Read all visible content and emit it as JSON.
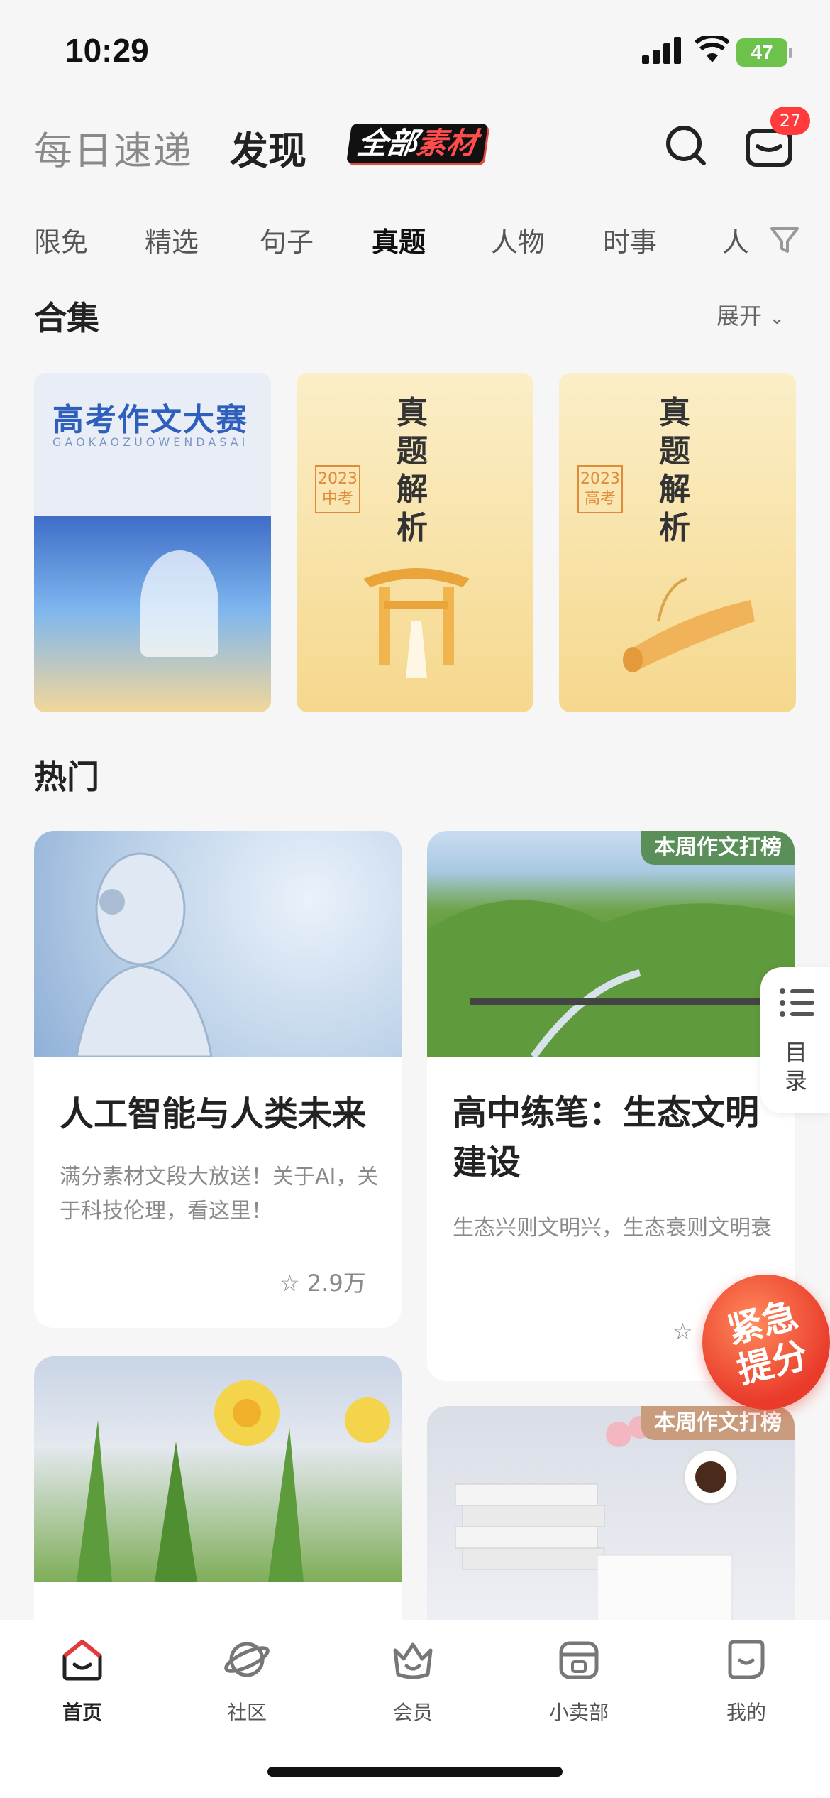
{
  "status_bar": {
    "time": "10:29",
    "battery": "47"
  },
  "header": {
    "tabs": [
      {
        "label": "每日速递"
      },
      {
        "label": "发现"
      }
    ],
    "all_materials": {
      "part1": "全部",
      "part2": "素材"
    },
    "mail_badge": "27"
  },
  "categories": [
    "限免",
    "精选",
    "句子",
    "真题",
    "人物",
    "时事",
    "人"
  ],
  "collections": {
    "title": "合集",
    "expand_label": "展开",
    "items": [
      {
        "title": "高考作文大赛",
        "subtitle": "GAOKAOZUOWENDASAI"
      },
      {
        "title": "真题解析",
        "tag_year": "2023",
        "tag_level": "中考"
      },
      {
        "title": "真题解析",
        "tag_year": "2023",
        "tag_level": "高考"
      }
    ]
  },
  "hot": {
    "title": "热门",
    "cards": [
      {
        "title": "人工智能与人类未来",
        "desc": "满分素材文段大放送！关于AI，关于科技伦理，看这里！",
        "stars": "2.9万",
        "image": "ai-robot"
      },
      {
        "title": "高中练笔：生态文明建设",
        "desc": "生态兴则文明兴，生态衰则文明衰",
        "tag": "本周作文打榜",
        "image": "green-valley"
      },
      {
        "title": "",
        "image": "daffodil"
      },
      {
        "title": "",
        "tag": "本周作文打榜",
        "image": "books-coffee"
      }
    ]
  },
  "side": {
    "toc_label": "目录",
    "urgent": "紧急提分"
  },
  "bottom_nav": [
    {
      "label": "首页",
      "icon": "home-icon",
      "active": true
    },
    {
      "label": "社区",
      "icon": "planet-icon"
    },
    {
      "label": "会员",
      "icon": "crown-icon"
    },
    {
      "label": "小卖部",
      "icon": "shop-icon"
    },
    {
      "label": "我的",
      "icon": "profile-icon"
    }
  ],
  "colors": {
    "accent": "#ff3b3b",
    "rank_green": "#5b8f5a",
    "rank_warm": "#c99c7d"
  }
}
